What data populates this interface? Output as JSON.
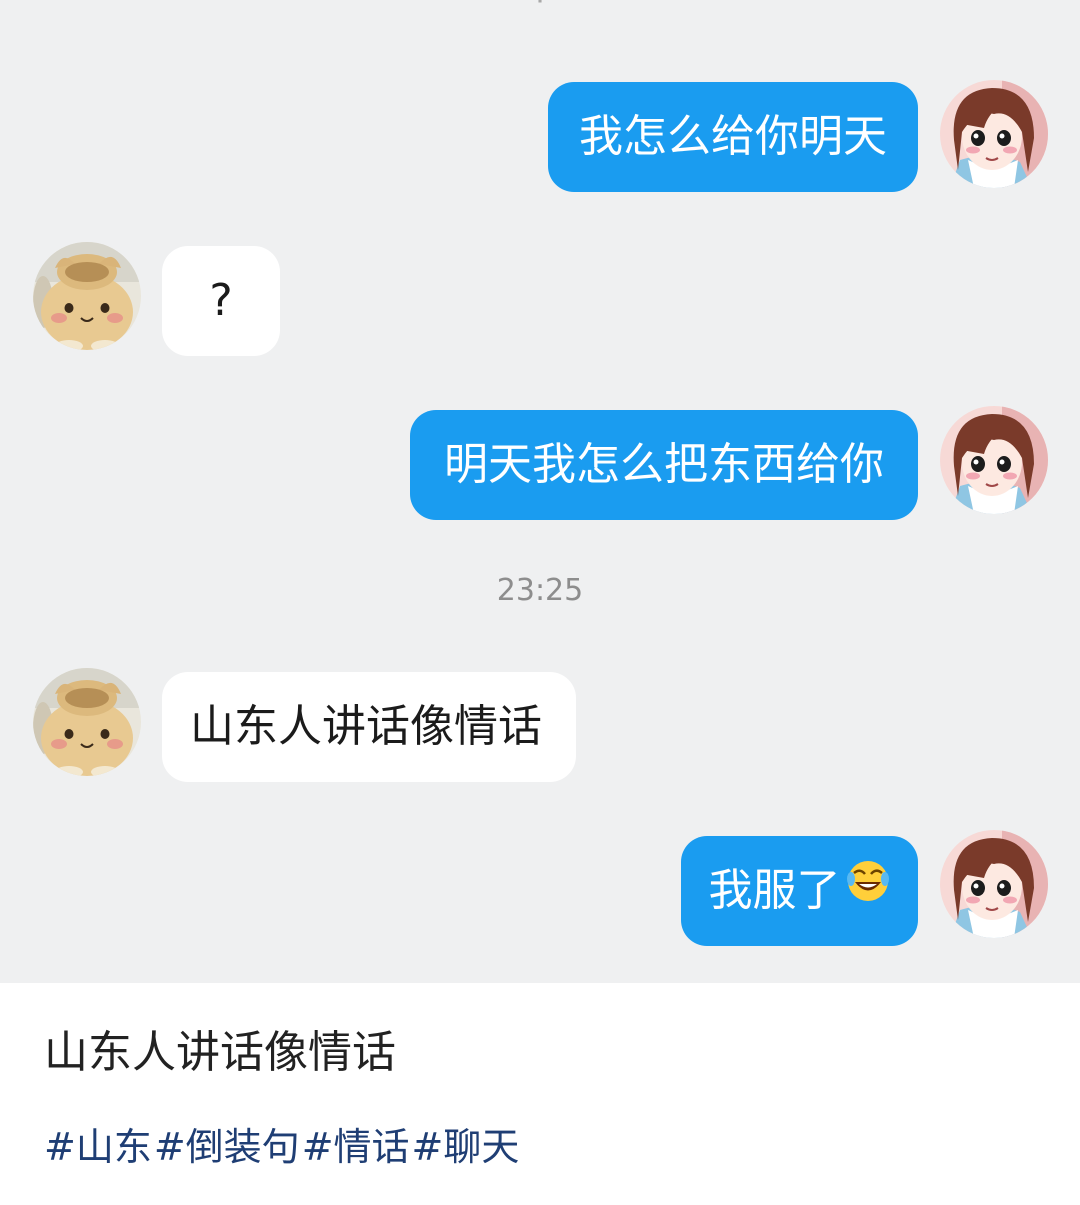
{
  "chat": {
    "messages": [
      {
        "side": "out",
        "text": "我怎么给你明天"
      },
      {
        "side": "in",
        "text": "?"
      },
      {
        "side": "out",
        "text": "明天我怎么把东西给你"
      },
      {
        "side": "in",
        "text": "山东人讲话像情话"
      },
      {
        "side": "out",
        "text": "我服了",
        "emoji": "laughing-tears-emoji"
      }
    ],
    "timestamp": "23:25"
  },
  "caption": {
    "title": "山东人讲话像情话",
    "tags": [
      "#山东",
      "#倒装句",
      "#情话",
      "#聊天"
    ]
  },
  "colors": {
    "chat_background": "#eff0f1",
    "outgoing_bubble": "#1a9cf0",
    "incoming_bubble": "#ffffff",
    "tag_color": "#1f3e74"
  },
  "icons": {
    "outgoing_avatar": "anime-girl-avatar",
    "incoming_avatar": "plush-toy-avatar"
  }
}
